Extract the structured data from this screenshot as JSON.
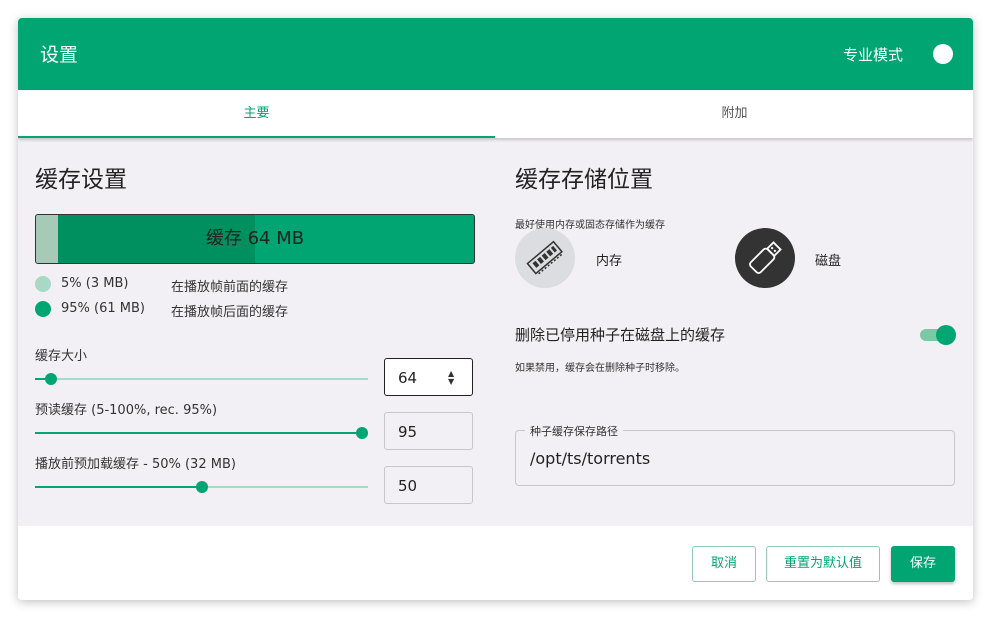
{
  "header": {
    "title": "设置",
    "pro_mode_label": "专业模式"
  },
  "tabs": [
    {
      "label": "主要",
      "active": true
    },
    {
      "label": "附加",
      "active": false
    }
  ],
  "cache": {
    "section_title": "缓存设置",
    "bar_label": "缓存 64 MB",
    "before_fraction": 0.05,
    "after_fraction": 0.45,
    "legend": [
      {
        "percent": "5% (3 MB)",
        "desc": "在播放帧前面的缓存",
        "color": "#a7d9c5"
      },
      {
        "percent": "95% (61 MB)",
        "desc": "在播放帧后面的缓存",
        "color": "#00a572"
      }
    ],
    "size": {
      "label": "缓存大小",
      "value": "64",
      "level": 0.03
    },
    "readahead": {
      "label": "预读缓存 (5-100%, rec. 95%)",
      "value": "95",
      "level": 1.0
    },
    "preload": {
      "label": "播放前预加载缓存 - 50% (32 MB)",
      "value": "50",
      "level": 0.5
    }
  },
  "storage": {
    "section_title": "缓存存储位置",
    "subtitle": "最好使用内存或固态存储作为缓存",
    "options": [
      {
        "label": "内存",
        "icon": "memory-icon"
      },
      {
        "label": "磁盘",
        "icon": "usb-drive-icon"
      }
    ],
    "delete_label": "删除已停用种子在磁盘上的缓存",
    "delete_hint": "如果禁用，缓存会在删除种子时移除。",
    "delete_enabled": true,
    "path_legend": "种子缓存保存路径",
    "path_value": "/opt/ts/torrents"
  },
  "footer": {
    "cancel": "取消",
    "reset": "重置为默认值",
    "save": "保存"
  },
  "colors": {
    "accent": "#00a572",
    "light_accent": "#a7d9c5",
    "background": "#f2f0f4"
  }
}
